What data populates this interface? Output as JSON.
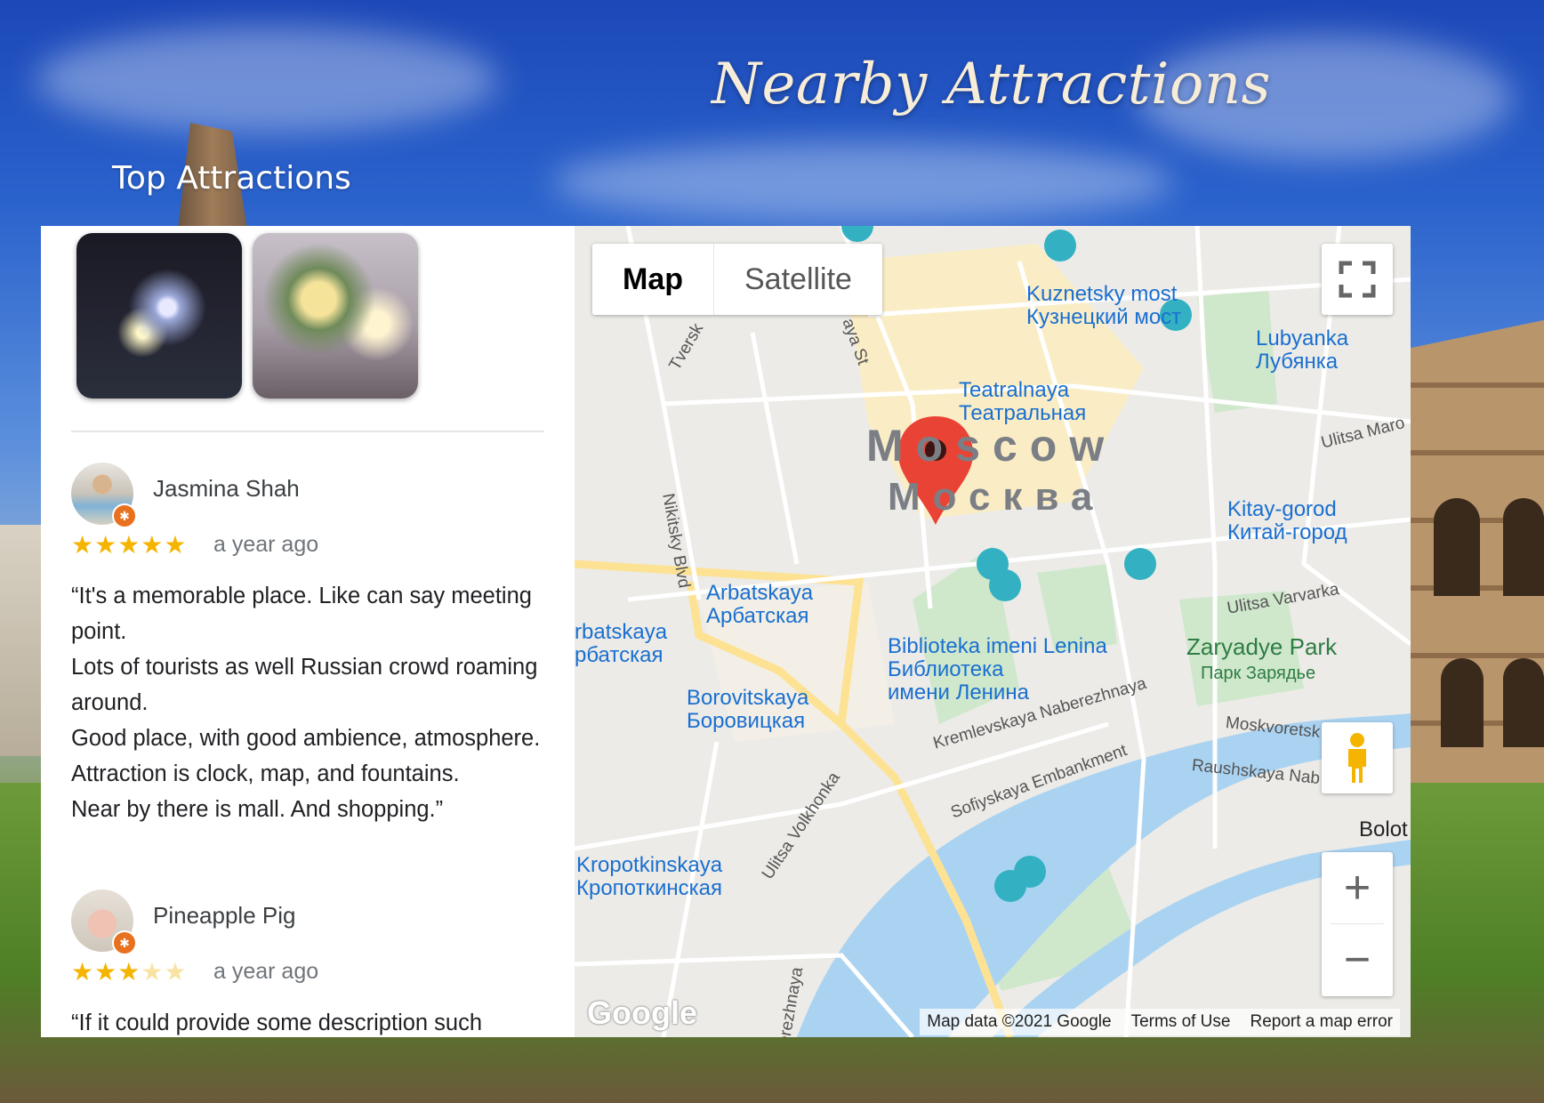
{
  "header": {
    "title": "Nearby Attractions",
    "section_heading": "Top Attractions"
  },
  "photos": [
    {
      "icon": "photo-lights-mask"
    },
    {
      "icon": "photo-christmas-tree"
    }
  ],
  "reviews": [
    {
      "name": "Jasmina Shah",
      "rating": 5,
      "stars_filled": "★★★★★",
      "stars_empty": "",
      "time": "a year ago",
      "text": "“It's a memorable place. Like can say meeting point.\nLots of tourists as well Russian crowd roaming around.\nGood place, with good ambience, atmosphere.\nAttraction is clock, map, and fountains.\nNear by there is mall. And shopping.”"
    },
    {
      "name": "Pineapple Pig",
      "rating": 3,
      "stars_filled": "★★★",
      "stars_empty": "★★",
      "time": "a year ago",
      "text": "“If it could provide some description such"
    }
  ],
  "map": {
    "type_map": "Map",
    "type_satellite": "Satellite",
    "zoom_in": "+",
    "zoom_out": "−",
    "city_en": "Moscow",
    "city_ru": "Москва",
    "labels": {
      "kuznetsky": "Kuznetsky most",
      "kuznetsky_ru": "Кузнецкий мост",
      "lubyanka": "Lubyanka",
      "lubyanka_ru": "Лубянка",
      "teatralnaya": "Teatralnaya",
      "teatralnaya_ru": "Театральная",
      "kitay": "Kitay-gorod",
      "kitay_ru": "Китай-город",
      "arbatskaya": "Arbatskaya",
      "arbatskaya_ru": "Арбатская",
      "arbatskaya2": "rbatskaya",
      "arbatskaya2_ru": "рбатская",
      "biblioteka": "Biblioteka imeni Lenina",
      "biblioteka_ru": "Библиотека",
      "biblioteka_ru2": "имени Ленина",
      "borovitskaya": "Borovitskaya",
      "borovitskaya_ru": "Боровицкая",
      "zaryadye": "Zaryadye Park",
      "zaryadye_ru": "Парк Зарядье",
      "kropotkinskaya": "Kropotkinskaya",
      "kropotkinskaya_ru": "Кропоткинская",
      "kremlevskaya": "Kremlevskaya Naberezhnaya",
      "sofiyskaya": "Sofiyskaya Embankment",
      "raushskaya": "Raushskaya Nab",
      "moskvoretskaya": "Moskvoretsk",
      "varvarka": "Ulitsa Varvarka",
      "volkhonka": "Ulitsa Volkhonka",
      "nikitsky": "Nikitsky Blvd",
      "tverskaya": "Tversk",
      "bolshaya": "aya St",
      "ulitsa_maro": "Ulitsa Maro",
      "bolot": "Bolot",
      "naberezhnaya": "erezhnaya"
    },
    "attribution": {
      "data": "Map data ©2021 Google",
      "terms": "Terms of Use",
      "report": "Report a map error"
    },
    "logo": "Google"
  }
}
